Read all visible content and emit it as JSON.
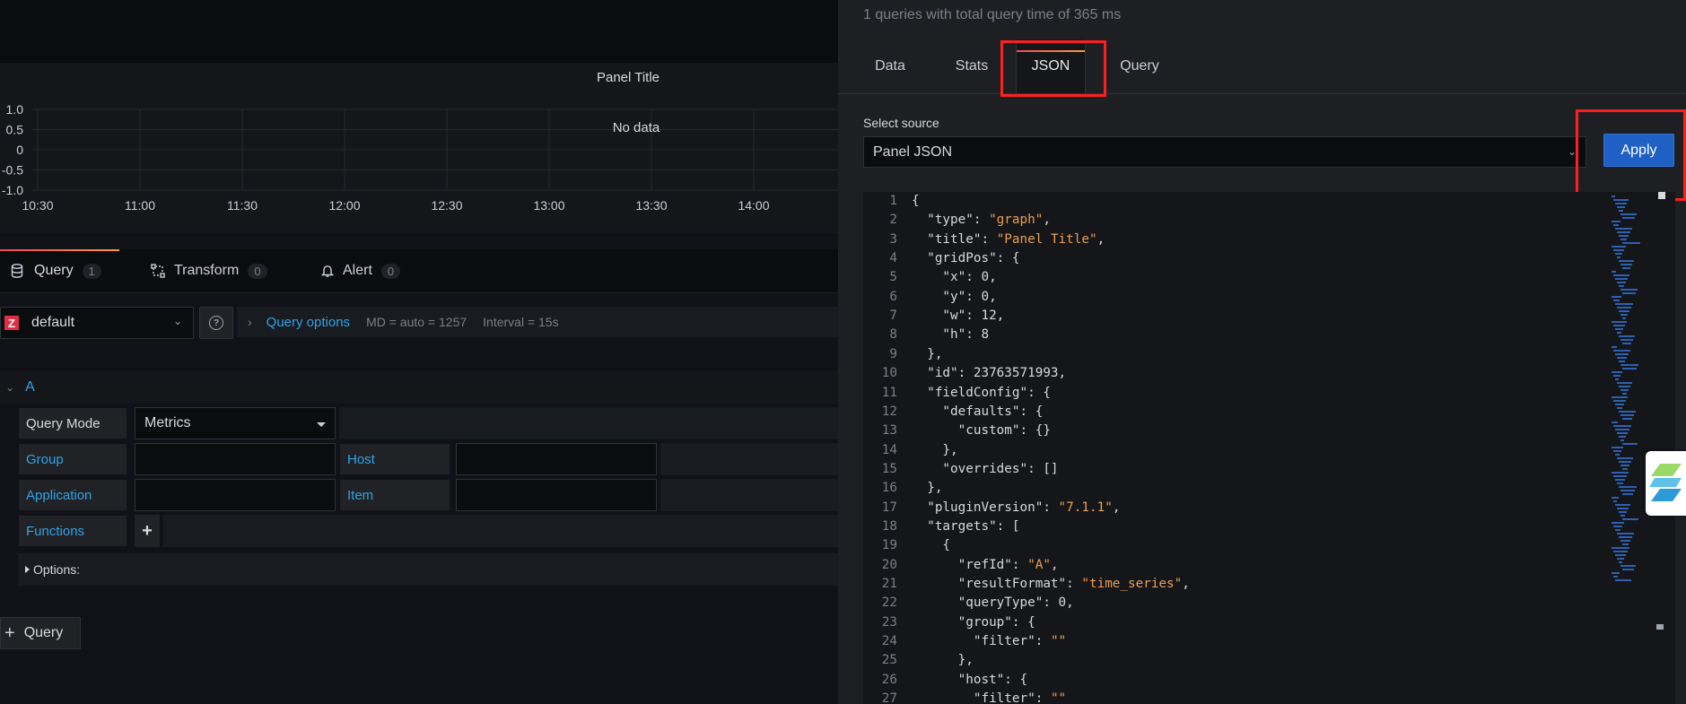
{
  "panel": {
    "title": "Panel Title",
    "no_data": "No data",
    "y_ticks": [
      "1.0",
      "0.5",
      "0",
      "-0.5",
      "-1.0"
    ],
    "x_ticks": [
      "10:30",
      "11:00",
      "11:30",
      "12:00",
      "12:30",
      "13:00",
      "13:30",
      "14:00"
    ]
  },
  "left_tabs": [
    {
      "label": "Query",
      "count": "1",
      "icon": "database-icon"
    },
    {
      "label": "Transform",
      "count": "0",
      "icon": "transform-icon"
    },
    {
      "label": "Alert",
      "count": "0",
      "icon": "bell-icon"
    }
  ],
  "datasource": {
    "logo_letter": "Z",
    "name": "default"
  },
  "query_options": {
    "label": "Query options",
    "md": "MD = auto = 1257",
    "interval": "Interval = 15s"
  },
  "query_a": {
    "label": "A"
  },
  "fields": {
    "query_mode_label": "Query Mode",
    "query_mode_value": "Metrics",
    "group_label": "Group",
    "host_label": "Host",
    "application_label": "Application",
    "item_label": "Item",
    "functions_label": "Functions",
    "options_label": "Options:"
  },
  "add_query_label": "Query",
  "inspector": {
    "query_info": "1 queries with total query time of 365 ms",
    "tabs": [
      "Data",
      "Stats",
      "JSON",
      "Query"
    ],
    "active_tab": "JSON",
    "select_source_label": "Select source",
    "select_source_value": "Panel JSON",
    "apply_label": "Apply"
  },
  "json_lines": [
    "{",
    "  \"type\": \"graph\",",
    "  \"title\": \"Panel Title\",",
    "  \"gridPos\": {",
    "    \"x\": 0,",
    "    \"y\": 0,",
    "    \"w\": 12,",
    "    \"h\": 8",
    "  },",
    "  \"id\": 23763571993,",
    "  \"fieldConfig\": {",
    "    \"defaults\": {",
    "      \"custom\": {}",
    "    },",
    "    \"overrides\": []",
    "  },",
    "  \"pluginVersion\": \"7.1.1\",",
    "  \"targets\": [",
    "    {",
    "      \"refId\": \"A\",",
    "      \"resultFormat\": \"time_series\",",
    "      \"queryType\": 0,",
    "      \"group\": {",
    "        \"filter\": \"\"",
    "      },",
    "      \"host\": {",
    "        \"filter\": \"\""
  ],
  "colors": {
    "accent_blue": "#33a2e5",
    "apply_blue": "#1f60c4",
    "highlight_red": "#ff1f1f",
    "json_string": "#ea9e55"
  }
}
